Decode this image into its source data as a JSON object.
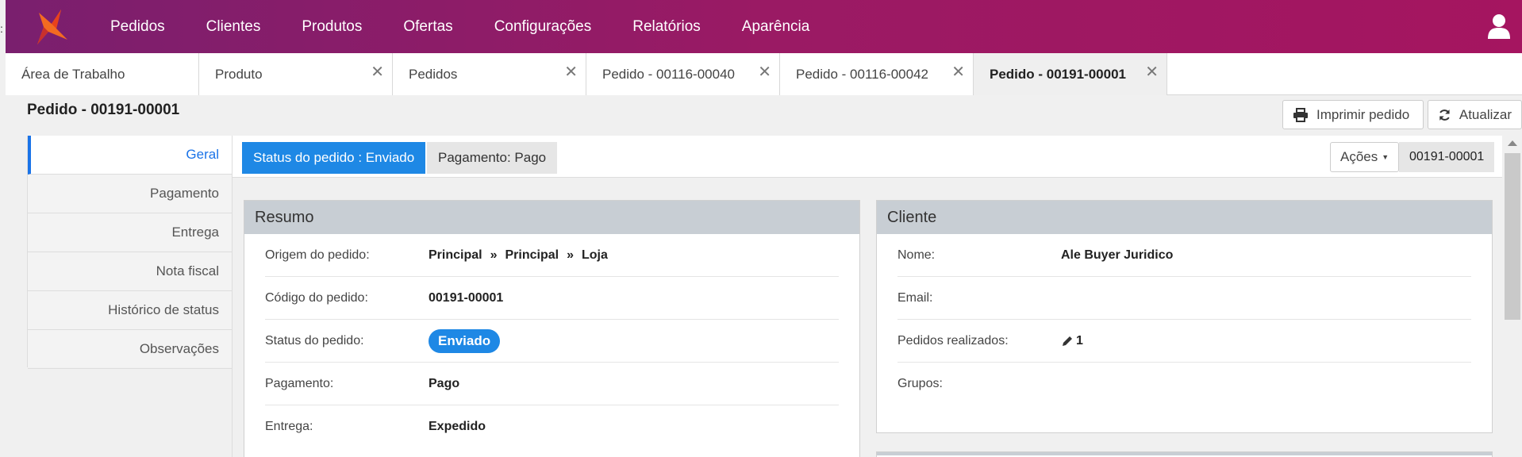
{
  "nav": {
    "items": [
      "Pedidos",
      "Clientes",
      "Produtos",
      "Ofertas",
      "Configurações",
      "Relatórios",
      "Aparência"
    ],
    "brand_color": "#9a1a64"
  },
  "tabs": [
    {
      "label": "Área de Trabalho",
      "closable": false,
      "active": false
    },
    {
      "label": "Produto",
      "closable": true,
      "active": false
    },
    {
      "label": "Pedidos",
      "closable": true,
      "active": false
    },
    {
      "label": "Pedido - 00116-00040",
      "closable": true,
      "active": false
    },
    {
      "label": "Pedido - 00116-00042",
      "closable": true,
      "active": false
    },
    {
      "label": "Pedido - 00191-00001",
      "closable": true,
      "active": true
    }
  ],
  "page": {
    "title": "Pedido - 00191-00001",
    "print_label": "Imprimir pedido",
    "refresh_label": "Atualizar"
  },
  "sidebar": {
    "items": [
      "Geral",
      "Pagamento",
      "Entrega",
      "Nota fiscal",
      "Histórico de status",
      "Observações"
    ],
    "active": "Geral"
  },
  "subbar": {
    "status_label": "Status do pedido : Enviado",
    "payment_label": "Pagamento: Pago",
    "actions_label": "Ações",
    "order_code": "00191-00001"
  },
  "resumo": {
    "title": "Resumo",
    "origem_label": "Origem do pedido:",
    "origem_parts": [
      "Principal",
      "Principal",
      "Loja"
    ],
    "origem_sep": "»",
    "codigo_label": "Código do pedido:",
    "codigo_value": "00191-00001",
    "status_label": "Status do pedido:",
    "status_value": "Enviado",
    "pagamento_label": "Pagamento:",
    "pagamento_value": "Pago",
    "entrega_label": "Entrega:",
    "entrega_value": "Expedido"
  },
  "cliente": {
    "title": "Cliente",
    "nome_label": "Nome:",
    "nome_value": "Ale Buyer Juridico",
    "email_label": "Email:",
    "email_value": "",
    "pedidos_label": "Pedidos realizados:",
    "pedidos_value": "1",
    "grupos_label": "Grupos:",
    "grupos_value": ""
  },
  "colors": {
    "accent": "#1e88e5",
    "panel_header": "#c8ced4"
  }
}
